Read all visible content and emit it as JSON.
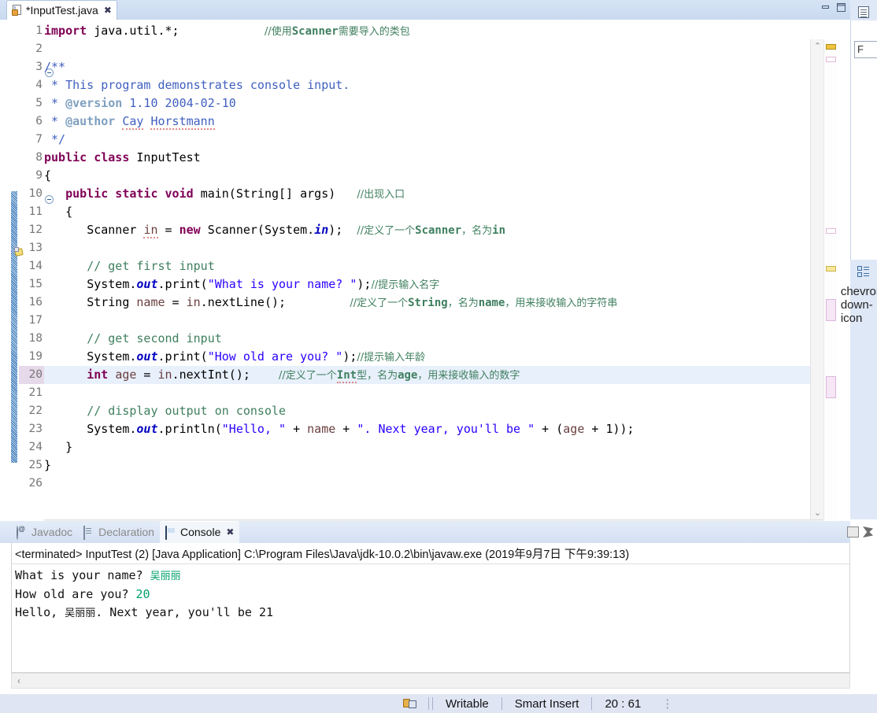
{
  "window": {
    "minimize_label": "minimize",
    "maximize_label": "maximize"
  },
  "editor": {
    "tab": {
      "label": "*InputTest.java",
      "close": "✖",
      "icon": "java-file-icon"
    },
    "highlighted_line": 20,
    "lines": [
      {
        "n": 1,
        "html": "<span class='kw'>import</span> <span class='plain'>java.util.*;</span>            <span class='cn-cmt'>//使用<b>Scanner</b>需要导入的类包</span>"
      },
      {
        "n": 2,
        "html": ""
      },
      {
        "n": 3,
        "html": "<span class='jdoc'>/**</span>"
      },
      {
        "n": 4,
        "html": " <span class='jdoc'>* This program demonstrates console input.</span>"
      },
      {
        "n": 5,
        "html": " <span class='jdoc'>* </span><span class='jtag'>@version</span><span class='jdoc'> 1.10 2004-02-10</span>"
      },
      {
        "n": 6,
        "html": " <span class='jdoc'>* </span><span class='jtag'>@author</span><span class='jdoc'> </span><span class='jdoc sq-under'>Cay</span><span class='jdoc'> </span><span class='jdoc sq-under'>Horstmann</span>"
      },
      {
        "n": 7,
        "html": " <span class='jdoc'>*/</span>"
      },
      {
        "n": 8,
        "html": "<span class='kw'>public class</span> <span class='plain'>InputTest</span>"
      },
      {
        "n": 9,
        "html": "<span class='plain'>{</span>"
      },
      {
        "n": 10,
        "html": "   <span class='kw'>public static void</span> <span class='plain'>main(String[] args)</span>   <span class='cn-cmt'>//出现入口</span>"
      },
      {
        "n": 11,
        "html": "   <span class='plain'>{</span>"
      },
      {
        "n": 12,
        "html": "      <span class='plain'>Scanner </span><span class='lvar sq-under'>in</span><span class='plain'> = </span><span class='kw'>new</span><span class='plain'> Scanner(System.</span><span class='fld'>in</span><span class='plain'>);</span>  <span class='cn-cmt'>//定义了一个<b>Scanner</b>，名为<b>in</b></span>"
      },
      {
        "n": 13,
        "html": ""
      },
      {
        "n": 14,
        "html": "      <span class='cmt'>// get first input</span>"
      },
      {
        "n": 15,
        "html": "      <span class='plain'>System.</span><span class='fld'>out</span><span class='plain'>.print(</span><span class='str'>\"What is your name? \"</span><span class='plain'>);</span><span class='cn-cmt'>//提示输入名字</span>"
      },
      {
        "n": 16,
        "html": "      <span class='plain'>String </span><span class='lvar'>name</span><span class='plain'> = </span><span class='lvar'>in</span><span class='plain'>.nextLine();</span>         <span class='cn-cmt'>//定义了一个<b>String</b>，名为<b>name</b>，用来接收输入的字符串</span>"
      },
      {
        "n": 17,
        "html": ""
      },
      {
        "n": 18,
        "html": "      <span class='cmt'>// get second input</span>"
      },
      {
        "n": 19,
        "html": "      <span class='plain'>System.</span><span class='fld'>out</span><span class='plain'>.print(</span><span class='str'>\"How old are you? \"</span><span class='plain'>);</span><span class='cn-cmt'>//提示输入年龄</span>"
      },
      {
        "n": 20,
        "html": "      <span class='kw'>int</span> <span class='lvar'>age</span><span class='plain'> = </span><span class='lvar'>in</span><span class='plain'>.nextInt();</span>    <span class='cn-cmt'>//定义了一个<b class='sq-under'>Int</b>型，名为<b>age</b>，用来接收输入的数字</span>"
      },
      {
        "n": 21,
        "html": ""
      },
      {
        "n": 22,
        "html": "      <span class='cmt'>// display output on console</span>"
      },
      {
        "n": 23,
        "html": "      <span class='plain'>System.</span><span class='fld'>out</span><span class='plain'>.println(</span><span class='str'>\"Hello, \"</span><span class='plain'> + </span><span class='lvar'>name</span><span class='plain'> + </span><span class='str'>\". Next year, you'll be \"</span><span class='plain'> + (</span><span class='lvar'>age</span><span class='plain'> + 1));</span>"
      },
      {
        "n": 24,
        "html": "   <span class='plain'>}</span>"
      },
      {
        "n": 25,
        "html": "<span class='plain'>}</span>"
      },
      {
        "n": 26,
        "html": ""
      }
    ],
    "hscroll_left": "‹",
    "hscroll_right": "›",
    "vscroll_up": "⌃",
    "vscroll_down": "⌄"
  },
  "right_dock": {
    "outline_icon": "document-outline-icon",
    "filter_text": "F",
    "collapse_icon": "chevron-down-icon",
    "structure_icon": "outline-structure-icon"
  },
  "console": {
    "tabs": [
      {
        "label": "Javadoc",
        "icon": "javadoc-icon",
        "active": false,
        "closable": false
      },
      {
        "label": "Declaration",
        "icon": "declaration-icon",
        "active": false,
        "closable": false
      },
      {
        "label": "Console",
        "icon": "console-icon",
        "active": true,
        "closable": true
      }
    ],
    "close_glyph": "✖",
    "toolbar": [
      "terminate-icon",
      "remove-launch-icon"
    ],
    "header": "<terminated> InputTest (2) [Java Application] C:\\Program Files\\Java\\jdk-10.0.2\\bin\\javaw.exe (2019年9月7日 下午9:39:13)",
    "output_lines": [
      {
        "prompt": "What is your name? ",
        "input": "吴丽丽",
        "input_is_cjk": true
      },
      {
        "prompt": "How old are you? ",
        "input": "20",
        "input_is_cjk": false
      },
      {
        "prompt": "Hello, ",
        "input": "",
        "tail_cjk": "吴丽丽",
        "tail": ". Next year, you'll be 21"
      }
    ],
    "hscroll_left": "‹"
  },
  "statusbar": {
    "writable": "Writable",
    "insert_mode": "Smart Insert",
    "position": "20 : 61",
    "icon": "editor-state-icon",
    "dots": "⋮"
  }
}
